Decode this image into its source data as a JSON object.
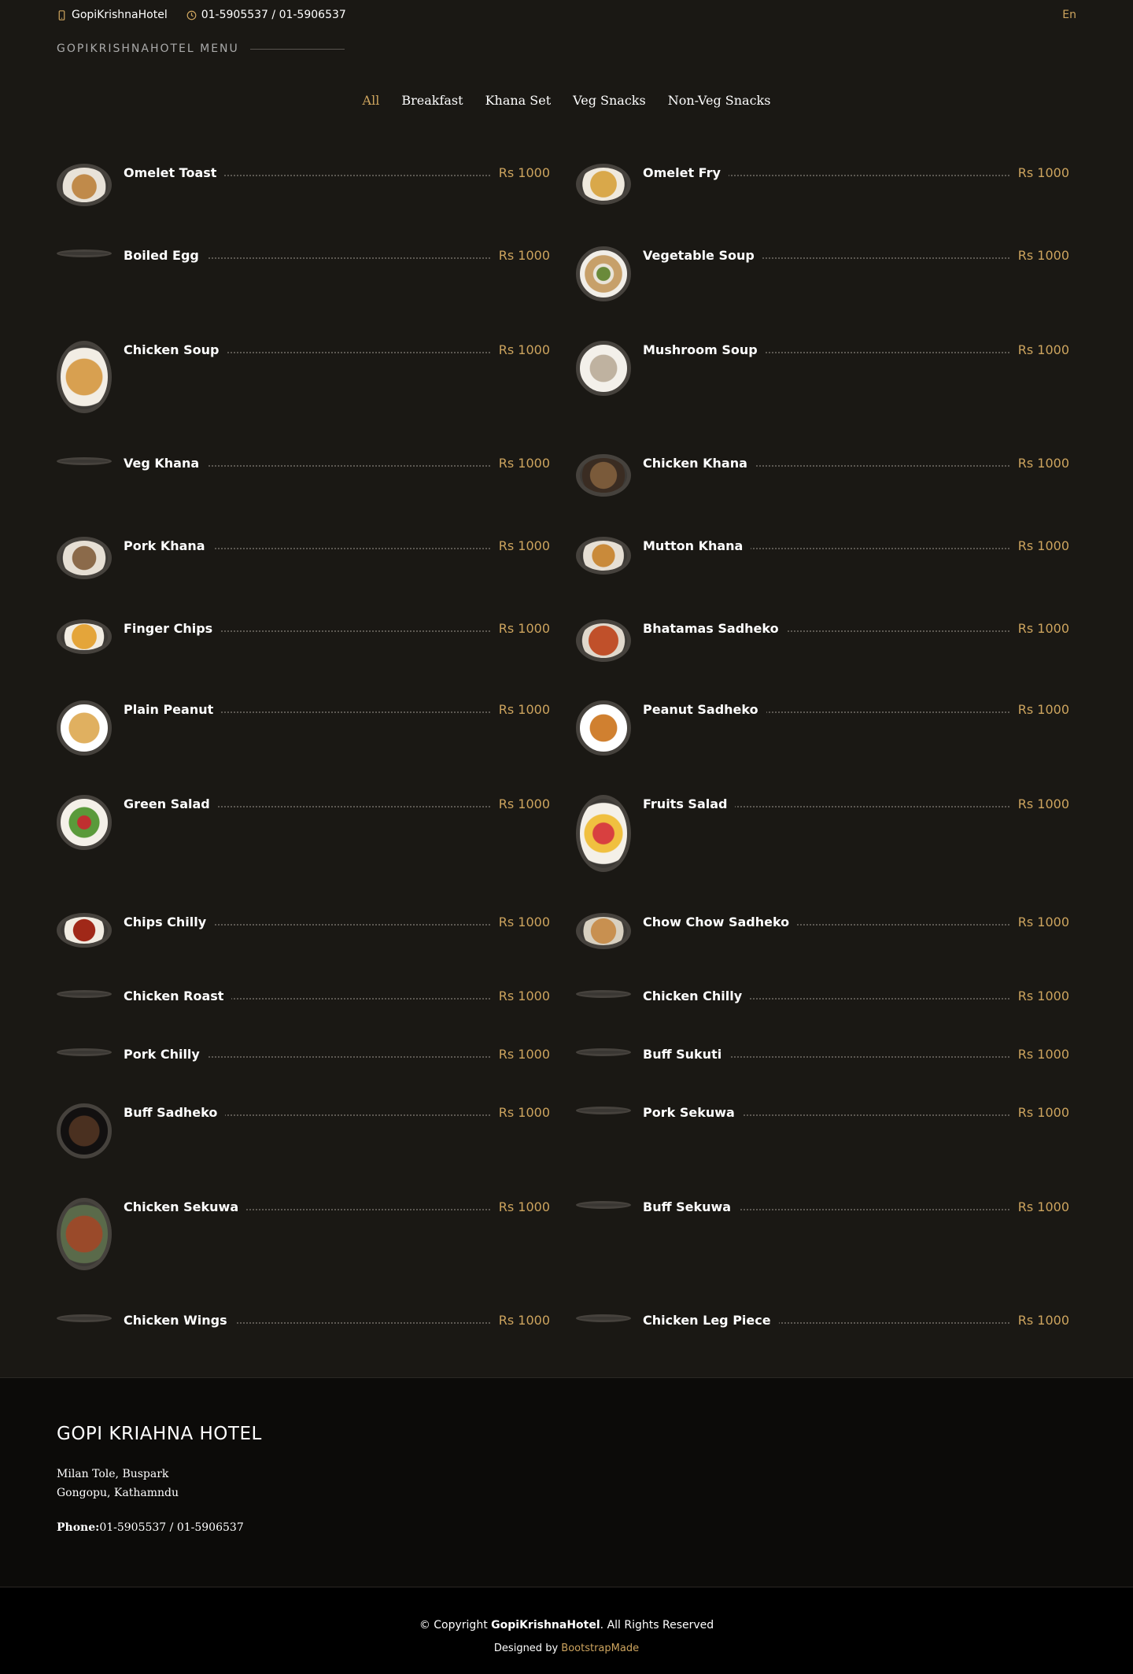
{
  "topbar": {
    "name": "GopiKrishnaHotel",
    "phone": "01-5905537 / 01-5906537",
    "lang": "En"
  },
  "section_title": "GOPIKRISHNAHOTEL MENU",
  "filters": [
    "All",
    "Breakfast",
    "Khana Set",
    "Veg Snacks",
    "Non-Veg Snacks"
  ],
  "active_filter": "All",
  "menu": [
    {
      "name": "Omelet Toast",
      "price": "Rs 1000",
      "image": "omelet-toast-plate"
    },
    {
      "name": "Omelet Fry",
      "price": "Rs 1000",
      "image": "omelet-fry-plate"
    },
    {
      "name": "Boiled Egg",
      "price": "Rs 1000",
      "image": "none"
    },
    {
      "name": "Vegetable Soup",
      "price": "Rs 1000",
      "image": "vegetable-soup-bowl"
    },
    {
      "name": "Chicken Soup",
      "price": "Rs 1000",
      "image": "chicken-soup-bowl"
    },
    {
      "name": "Mushroom Soup",
      "price": "Rs 1000",
      "image": "mushroom-soup-bowl"
    },
    {
      "name": "Veg Khana",
      "price": "Rs 1000",
      "image": "none"
    },
    {
      "name": "Chicken Khana",
      "price": "Rs 1000",
      "image": "chicken-khana-thali"
    },
    {
      "name": "Pork Khana",
      "price": "Rs 1000",
      "image": "pork-khana-thali"
    },
    {
      "name": "Mutton Khana",
      "price": "Rs 1000",
      "image": "mutton-khana-thali"
    },
    {
      "name": "Finger Chips",
      "price": "Rs 1000",
      "image": "finger-chips-plate"
    },
    {
      "name": "Bhatamas Sadheko",
      "price": "Rs 1000",
      "image": "bhatamas-sadheko-plate"
    },
    {
      "name": "Plain Peanut",
      "price": "Rs 1000",
      "image": "plain-peanut-bowl"
    },
    {
      "name": "Peanut Sadheko",
      "price": "Rs 1000",
      "image": "peanut-sadheko-plate"
    },
    {
      "name": "Green Salad",
      "price": "Rs 1000",
      "image": "green-salad-plate"
    },
    {
      "name": "Fruits Salad",
      "price": "Rs 1000",
      "image": "fruits-salad-bowl"
    },
    {
      "name": "Chips Chilly",
      "price": "Rs 1000",
      "image": "chips-chilly-plate"
    },
    {
      "name": "Chow Chow Sadheko",
      "price": "Rs 1000",
      "image": "chow-chow-sadheko-plate"
    },
    {
      "name": "Chicken Roast",
      "price": "Rs 1000",
      "image": "none"
    },
    {
      "name": "Chicken Chilly",
      "price": "Rs 1000",
      "image": "none"
    },
    {
      "name": "Pork Chilly",
      "price": "Rs 1000",
      "image": "none"
    },
    {
      "name": "Buff Sukuti",
      "price": "Rs 1000",
      "image": "none"
    },
    {
      "name": "Buff Sadheko",
      "price": "Rs 1000",
      "image": "buff-sadheko-plate"
    },
    {
      "name": "Pork Sekuwa",
      "price": "Rs 1000",
      "image": "none"
    },
    {
      "name": "Chicken Sekuwa",
      "price": "Rs 1000",
      "image": "chicken-sekuwa-plate"
    },
    {
      "name": "Buff Sekuwa",
      "price": "Rs 1000",
      "image": "none"
    },
    {
      "name": "Chicken Wings",
      "price": "Rs 1000",
      "image": "none"
    },
    {
      "name": "Chicken Leg Piece",
      "price": "Rs 1000",
      "image": "none"
    }
  ],
  "footer": {
    "title": "GOPI KRIAHNA HOTEL",
    "address_line1": "Milan Tole, Buspark",
    "address_line2": "Gongopu, Kathamndu",
    "phone_label": "Phone:",
    "phone_value": "01-5905537 / 01-5906537",
    "copyright_prefix": "© Copyright ",
    "copyright_brand": "GopiKrishnaHotel",
    "copyright_suffix": ". All Rights Reserved",
    "designed_by_prefix": "Designed by ",
    "designed_by_link": "BootstrapMade"
  },
  "colors": {
    "accent": "#cda45e",
    "background": "#1a1814",
    "footer": "#0c0b09",
    "footer_bottom": "#000000"
  }
}
